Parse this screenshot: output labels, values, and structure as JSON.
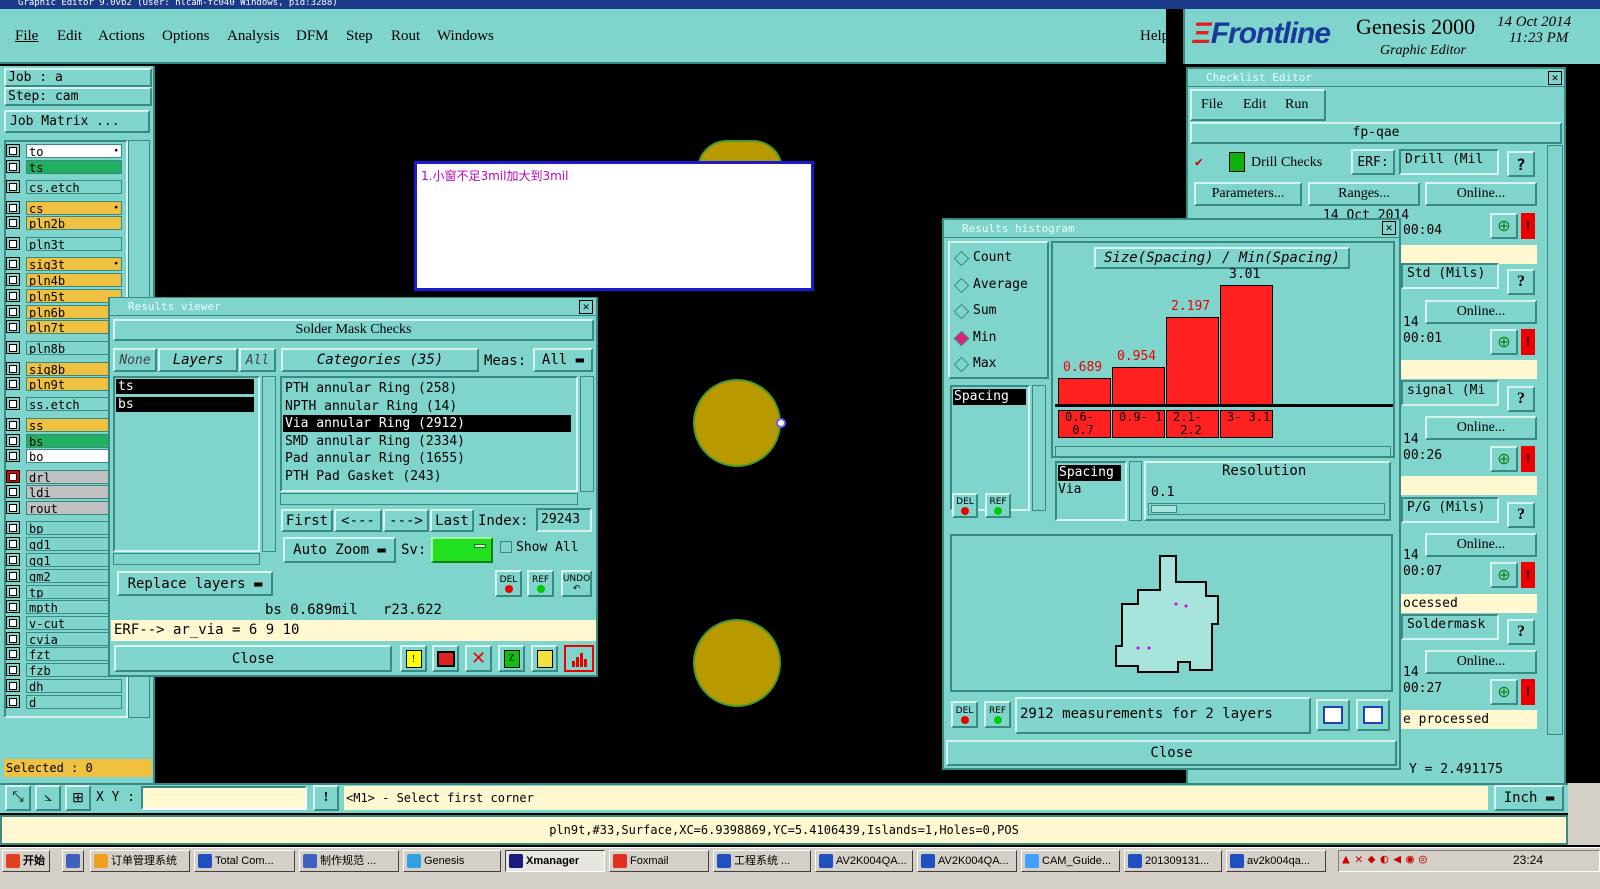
{
  "window_title": "Graphic Editor 9.0vb2 (User: hlcam-fc040 Windows, pid:3288)",
  "menu": [
    "File",
    "Edit",
    "Actions",
    "Options",
    "Analysis",
    "DFM",
    "Step",
    "Rout",
    "Windows"
  ],
  "help": "Help",
  "brand": {
    "logo": "Frontline",
    "product": "Genesis 2000",
    "sub": "Graphic Editor",
    "date": "14 Oct 2014",
    "time": "11:23 PM"
  },
  "job": {
    "job": "Job : a",
    "step": "Step: cam",
    "matrix": "Job Matrix ..."
  },
  "layers": [
    "to",
    "ts",
    "cs.etch",
    "cs",
    "pln2b",
    "pln3t",
    "sig3t",
    "pln4b",
    "pln5t",
    "pln6b",
    "pln7t",
    "pln8b",
    "sig8b",
    "pln9t",
    "ss.etch",
    "ss",
    "bs",
    "bo",
    "drl",
    "ldi",
    "rout",
    "bp",
    "gd1",
    "gg1",
    "gm2",
    "tp",
    "mpth",
    "v-cut",
    "cvia",
    "fzt",
    "fzb",
    "dh",
    "d"
  ],
  "selected": "Selected : 0",
  "note": "1.小窗不足3mil加大到3mil",
  "results_viewer": {
    "title": "Results viewer",
    "heading": "Solder Mask Checks",
    "none": "None",
    "layers": "Layers",
    "all": "All",
    "cat_btn": "Categories (35)",
    "meas": "Meas:",
    "meas_val": "All",
    "layer_list": [
      "ts",
      "bs"
    ],
    "categories": [
      "PTH annular Ring (258)",
      "NPTH annular Ring (14)",
      "Via annular Ring (2912)",
      "SMD annular Ring (2334)",
      "Pad annular Ring (1655)",
      "PTH Pad Gasket (243)"
    ],
    "first": "First",
    "prev": "<---",
    "next": "--->",
    "last": "Last",
    "index_lbl": "Index:",
    "index_val": "29243",
    "auto_zoom": "Auto Zoom",
    "sv": "Sv:",
    "show_all": "Show All",
    "replace": "Replace layers",
    "status": "bs 0.689mil   r23.622",
    "erf": "ERF--> ar_via = 6 9 10",
    "close": "Close",
    "del": "DEL",
    "ref": "REF",
    "undo": "UNDO"
  },
  "checklist": {
    "title": "Checklist Editor",
    "menu": [
      "File",
      "Edit",
      "Run"
    ],
    "name": "fp-qae",
    "check": "Drill Checks",
    "erf": "ERF:",
    "erf_val": "Drill (Mil",
    "params": "Parameters...",
    "ranges": "Ranges...",
    "online": "Online...",
    "date_row": "14 Oct 2014",
    "times": [
      "00:04",
      "00:01",
      "00:26",
      "00:07",
      "00:27"
    ],
    "names": [
      "Std (Mils)",
      "signal (Mi",
      "P/G (Mils)",
      "Soldermask"
    ],
    "processed": [
      "ocessed",
      "e processed"
    ],
    "qmark": "?",
    "coord": "Y = 2.491175"
  },
  "histogram": {
    "title": "Results histogram",
    "modes": [
      "Count",
      "Average",
      "Sum",
      "Min",
      "Max"
    ],
    "selected_mode": "Min",
    "chart_title": "Size(Spacing) / Min(Spacing)",
    "bins": [
      "0.6-0.7",
      "0.9-1",
      "2.1-2.2",
      "3-3.1"
    ],
    "bin_tops": [
      "0.7",
      "1",
      "2.2",
      "3.1"
    ],
    "values": [
      0.689,
      0.954,
      2.197,
      3.01
    ],
    "value_labels": [
      "0.689",
      "0.954",
      "2.197",
      "3.01"
    ],
    "list1": [
      "Spacing"
    ],
    "list2": [
      "Spacing",
      "Via"
    ],
    "resolution_lbl": "Resolution",
    "resolution_val": "0.1",
    "summary": "2912 measurements for 2 layers",
    "close": "Close"
  },
  "bottom": {
    "xy": "X Y :",
    "hint": "<M1> - Select first corner",
    "units": "Inch",
    "status": "pln9t,#33,Surface,XC=6.9398869,YC=5.4106439,Islands=1,Holes=0,POS"
  },
  "taskbar": {
    "start": "开始",
    "items": [
      "订单管理系统",
      "Total Com...",
      "制作规范 ...",
      "Genesis",
      "Xmanager",
      "Foxmail",
      "工程系统 ...",
      "AV2K004QA...",
      "AV2K004QA...",
      "CAM_Guide...",
      "201309131...",
      "av2k004qa..."
    ],
    "clock": "23:24"
  },
  "colors": {
    "panel": "#7fd4cc",
    "bar": "#ff2020",
    "pad": "#b89a00"
  }
}
